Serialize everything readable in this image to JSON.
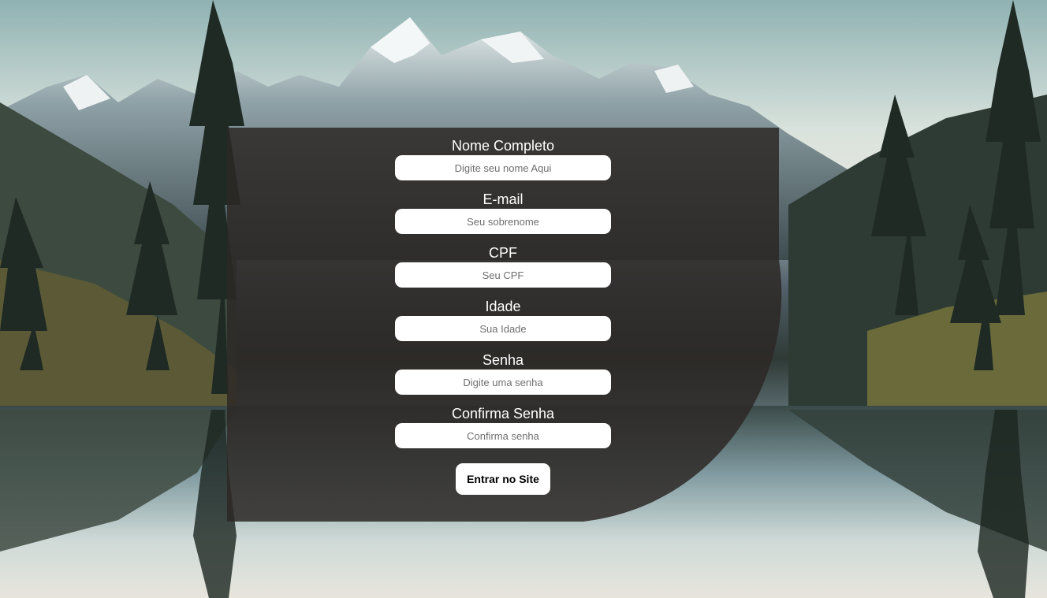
{
  "form": {
    "fields": [
      {
        "label": "Nome Completo",
        "placeholder": "Digite seu nome Aqui"
      },
      {
        "label": "E-mail",
        "placeholder": "Seu sobrenome"
      },
      {
        "label": "CPF",
        "placeholder": "Seu CPF"
      },
      {
        "label": "Idade",
        "placeholder": "Sua Idade"
      },
      {
        "label": "Senha",
        "placeholder": "Digite uma senha"
      },
      {
        "label": "Confirma Senha",
        "placeholder": "Confirma senha"
      }
    ],
    "submit_label": "Entrar no Site"
  },
  "colors": {
    "panel": "#2d2826",
    "input_bg": "#ffffff",
    "label_text": "#ffffff"
  }
}
